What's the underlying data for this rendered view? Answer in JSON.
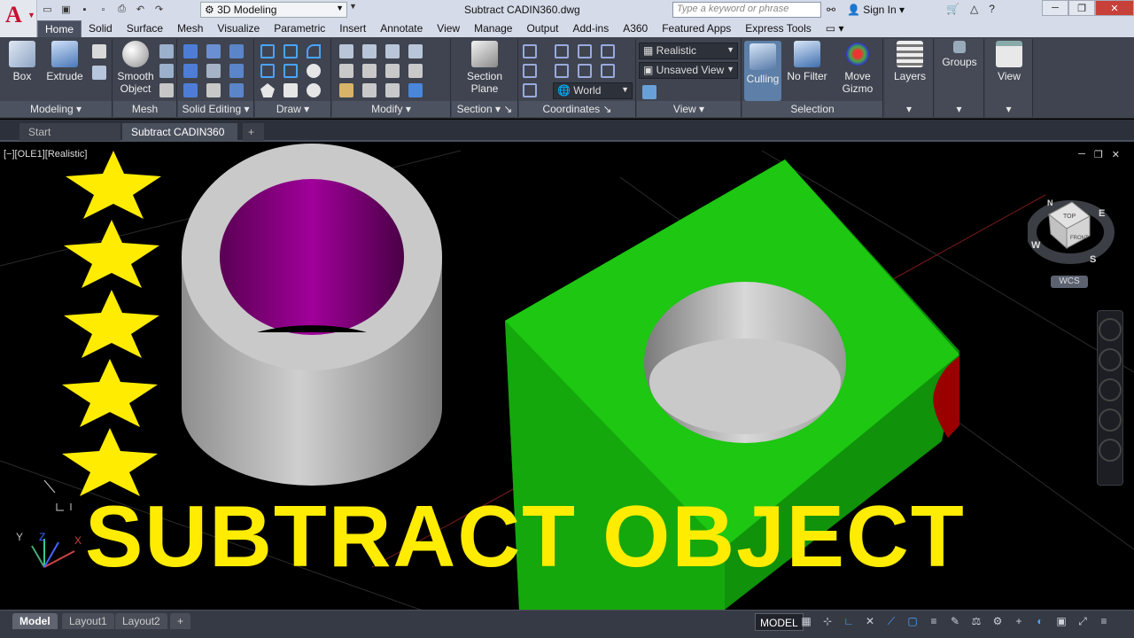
{
  "app": {
    "title": "Subtract CADIN360.dwg",
    "logo_letter": "A",
    "workspace": "3D Modeling",
    "search_placeholder": "Type a keyword or phrase",
    "sign_in": "Sign In",
    "accent_color": "#c8102e"
  },
  "ribbon": {
    "tabs": [
      "Home",
      "Solid",
      "Surface",
      "Mesh",
      "Visualize",
      "Parametric",
      "Insert",
      "Annotate",
      "View",
      "Manage",
      "Output",
      "Add-ins",
      "A360",
      "Featured Apps",
      "Express Tools"
    ],
    "active_tab": "Home",
    "panels": {
      "modeling": {
        "title": "Modeling",
        "box": "Box",
        "extrude": "Extrude"
      },
      "mesh": {
        "title": "Mesh",
        "smooth_line1": "Smooth",
        "smooth_line2": "Object"
      },
      "solid_editing": {
        "title": "Solid Editing"
      },
      "draw": {
        "title": "Draw"
      },
      "modify": {
        "title": "Modify"
      },
      "section": {
        "title": "Section",
        "sp_line1": "Section",
        "sp_line2": "Plane"
      },
      "coordinates": {
        "title": "Coordinates",
        "ucs": "World"
      },
      "view": {
        "title": "View",
        "visual_style": "Realistic",
        "named_view": "Unsaved View"
      },
      "selection": {
        "title": "Selection",
        "culling": "Culling",
        "no_filter": "No Filter",
        "gizmo_line1": "Move",
        "gizmo_line2": "Gizmo"
      },
      "layers": {
        "title": "Layers"
      },
      "groups": {
        "title": "Groups"
      },
      "viewp": {
        "title": "View"
      }
    }
  },
  "file_tabs": [
    "Start",
    "Subtract CADIN360"
  ],
  "active_file_tab": "Subtract CADIN360",
  "viewport": {
    "label": "[−][OLE1][Realistic]",
    "headline": "SUBTRACT OBJECT",
    "wcs": "WCS",
    "viewcube": {
      "top": "TOP",
      "front": "FRONT",
      "n": "N",
      "e": "E",
      "s": "S",
      "w": "W"
    },
    "colors": {
      "star": "#ffec00",
      "tube": "#b9b9b9",
      "tube_inner": "#8a007f",
      "block": "#19c40f",
      "block_dark": "#0e8a08",
      "cut": "#9a0000"
    }
  },
  "status": {
    "layouts": [
      "Model",
      "Layout1",
      "Layout2"
    ],
    "active_layout": "Model",
    "space": "MODEL"
  }
}
